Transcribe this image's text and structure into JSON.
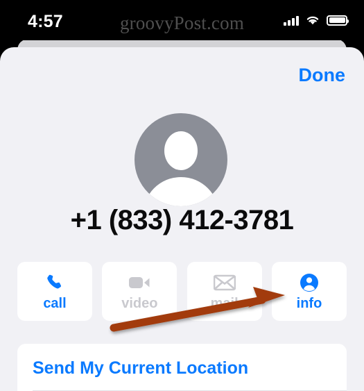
{
  "status_bar": {
    "time": "4:57",
    "watermark": "groovyPost.com",
    "icons": [
      "cellular-signal-icon",
      "wifi-icon",
      "battery-icon"
    ]
  },
  "sheet": {
    "done_label": "Done",
    "contact": {
      "avatar": "default-person-avatar",
      "phone_number": "+1 (833) 412-3781"
    },
    "actions": [
      {
        "label": "call",
        "icon": "phone-icon",
        "state": "enabled"
      },
      {
        "label": "video",
        "icon": "video-camera-icon",
        "state": "disabled"
      },
      {
        "label": "mail",
        "icon": "envelope-icon",
        "state": "disabled"
      },
      {
        "label": "info",
        "icon": "person-circle-icon",
        "state": "enabled"
      }
    ],
    "list": [
      {
        "label": "Send My Current Location"
      }
    ]
  },
  "annotation": {
    "type": "arrow",
    "points_to": "info",
    "color": "#a23a0c"
  },
  "colors": {
    "accent_blue": "#0a7aff",
    "disabled_grey": "#c9c9ce",
    "sheet_background": "#f1f1f5",
    "card_white": "#ffffff",
    "avatar_grey": "#8b8e97",
    "annotation_brown": "#a23a0c"
  }
}
